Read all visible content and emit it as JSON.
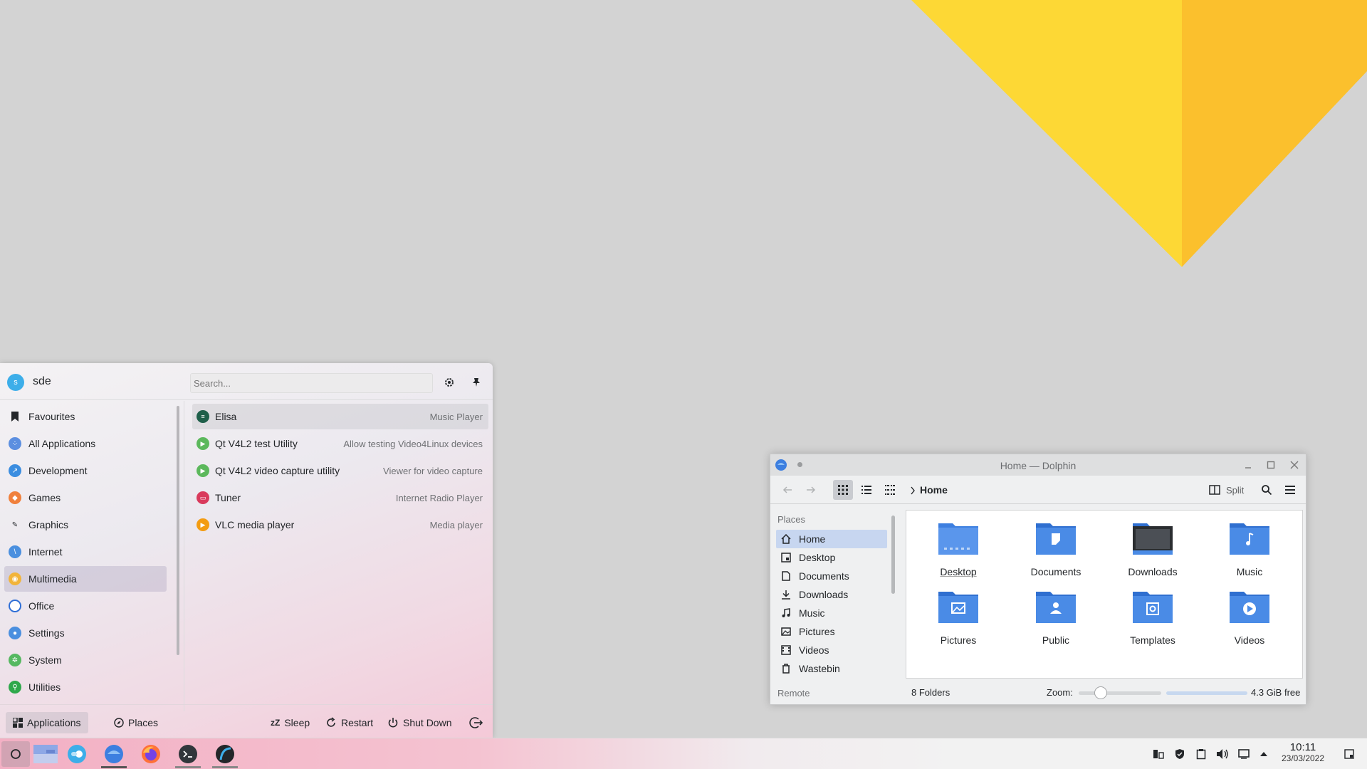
{
  "launcher": {
    "username": "sde",
    "avatar_initial": "s",
    "search": {
      "placeholder": "Search..."
    },
    "categories": [
      {
        "label": "Favourites",
        "icon": "bookmark-icon"
      },
      {
        "label": "All Applications",
        "icon": "all-apps-icon"
      },
      {
        "label": "Development",
        "icon": "development-icon"
      },
      {
        "label": "Games",
        "icon": "games-icon"
      },
      {
        "label": "Graphics",
        "icon": "graphics-icon"
      },
      {
        "label": "Internet",
        "icon": "internet-icon"
      },
      {
        "label": "Multimedia",
        "icon": "multimedia-icon"
      },
      {
        "label": "Office",
        "icon": "office-icon"
      },
      {
        "label": "Settings",
        "icon": "settings-icon"
      },
      {
        "label": "System",
        "icon": "system-icon"
      },
      {
        "label": "Utilities",
        "icon": "utilities-icon"
      }
    ],
    "active_category": "Multimedia",
    "apps": [
      {
        "name": "Elisa",
        "desc": "Music Player",
        "icon": "elisa-icon"
      },
      {
        "name": "Qt V4L2 test Utility",
        "desc": "Allow testing Video4Linux devices",
        "icon": "qv4l2-icon"
      },
      {
        "name": "Qt V4L2 video capture utility",
        "desc": "Viewer for video capture",
        "icon": "qvidcap-icon"
      },
      {
        "name": "Tuner",
        "desc": "Internet Radio Player",
        "icon": "tuner-icon"
      },
      {
        "name": "VLC media player",
        "desc": "Media player",
        "icon": "vlc-icon"
      }
    ],
    "footer": {
      "applications": "Applications",
      "places": "Places",
      "sleep": "Sleep",
      "restart": "Restart",
      "shutdown": "Shut Down"
    }
  },
  "taskbar": {
    "time": "10:11",
    "date": "23/03/2022"
  },
  "dolphin": {
    "title": "Home — Dolphin",
    "breadcrumb": "Home",
    "split_label": "Split",
    "places_header": "Places",
    "places": [
      {
        "label": "Home",
        "icon": "home-icon"
      },
      {
        "label": "Desktop",
        "icon": "desktop-icon"
      },
      {
        "label": "Documents",
        "icon": "documents-icon"
      },
      {
        "label": "Downloads",
        "icon": "download-icon"
      },
      {
        "label": "Music",
        "icon": "music-icon"
      },
      {
        "label": "Pictures",
        "icon": "pictures-icon"
      },
      {
        "label": "Videos",
        "icon": "videos-icon"
      },
      {
        "label": "Wastebin",
        "icon": "trash-icon"
      }
    ],
    "remote_header": "Remote",
    "folders": [
      {
        "label": "Desktop"
      },
      {
        "label": "Documents"
      },
      {
        "label": "Downloads"
      },
      {
        "label": "Music"
      },
      {
        "label": "Pictures"
      },
      {
        "label": "Public"
      },
      {
        "label": "Templates"
      },
      {
        "label": "Videos"
      }
    ],
    "status": "8 Folders",
    "zoom_label": "Zoom:",
    "free_space": "4.3 GiB free"
  },
  "colors": {
    "accent": "#3daee9",
    "folder_blue": "#3d7fe0",
    "wallpaper_yellow": "#fdd835",
    "wallpaper_orange": "#fbc02d"
  }
}
